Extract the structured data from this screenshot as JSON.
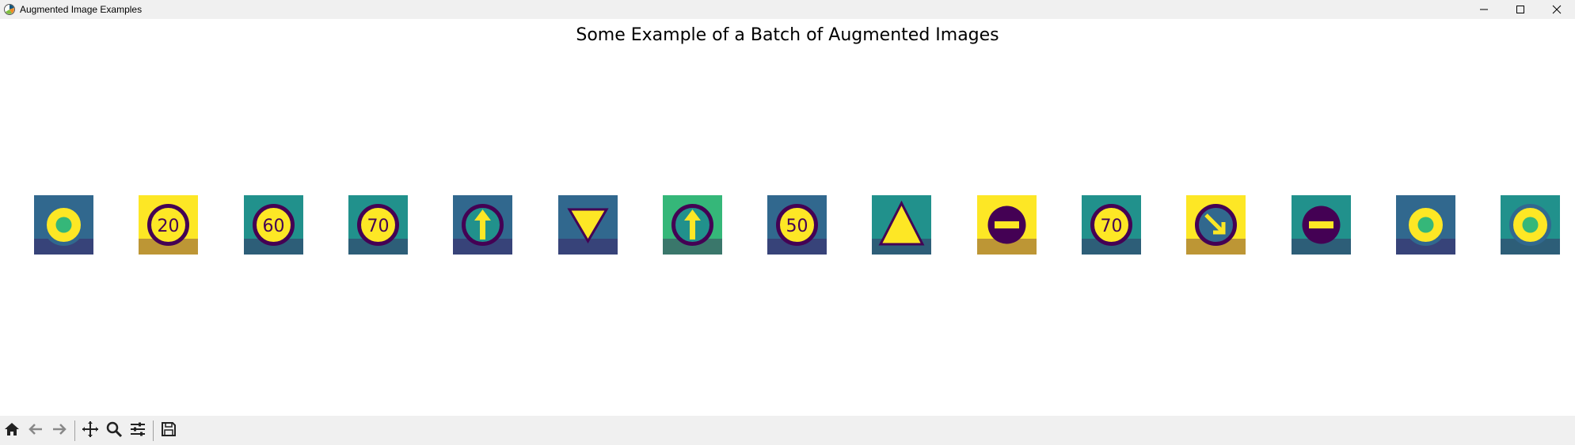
{
  "window": {
    "title": "Augmented Image Examples",
    "app_icon": "matplotlib-icon",
    "controls": [
      "minimize-icon",
      "maximize-icon",
      "close-icon"
    ]
  },
  "figure": {
    "title": "Some Example of a Batch of Augmented Images",
    "colormap": "viridis",
    "images": [
      {
        "kind": "round-sign",
        "text": ""
      },
      {
        "kind": "speed-limit",
        "text": "20"
      },
      {
        "kind": "speed-limit",
        "text": "60"
      },
      {
        "kind": "speed-limit",
        "text": "70"
      },
      {
        "kind": "arrow-up",
        "text": ""
      },
      {
        "kind": "yield",
        "text": ""
      },
      {
        "kind": "arrow-up",
        "text": ""
      },
      {
        "kind": "speed-limit",
        "text": "50"
      },
      {
        "kind": "warning-triangle",
        "text": ""
      },
      {
        "kind": "no-entry",
        "text": ""
      },
      {
        "kind": "speed-limit",
        "text": "70"
      },
      {
        "kind": "keep-right",
        "text": ""
      },
      {
        "kind": "no-entry",
        "text": ""
      },
      {
        "kind": "round-sign",
        "text": ""
      },
      {
        "kind": "round-sign",
        "text": ""
      }
    ]
  },
  "toolbar": {
    "buttons": [
      "home-icon",
      "back-icon",
      "forward-icon",
      "pan-icon",
      "zoom-icon",
      "configure-subplots-icon",
      "save-icon"
    ]
  },
  "colors": {
    "viridis_dark": "#440154",
    "viridis_blue": "#31688e",
    "viridis_teal": "#21918c",
    "viridis_green": "#35b779",
    "viridis_yellow": "#fde725",
    "chrome": "#f0f0f0"
  }
}
